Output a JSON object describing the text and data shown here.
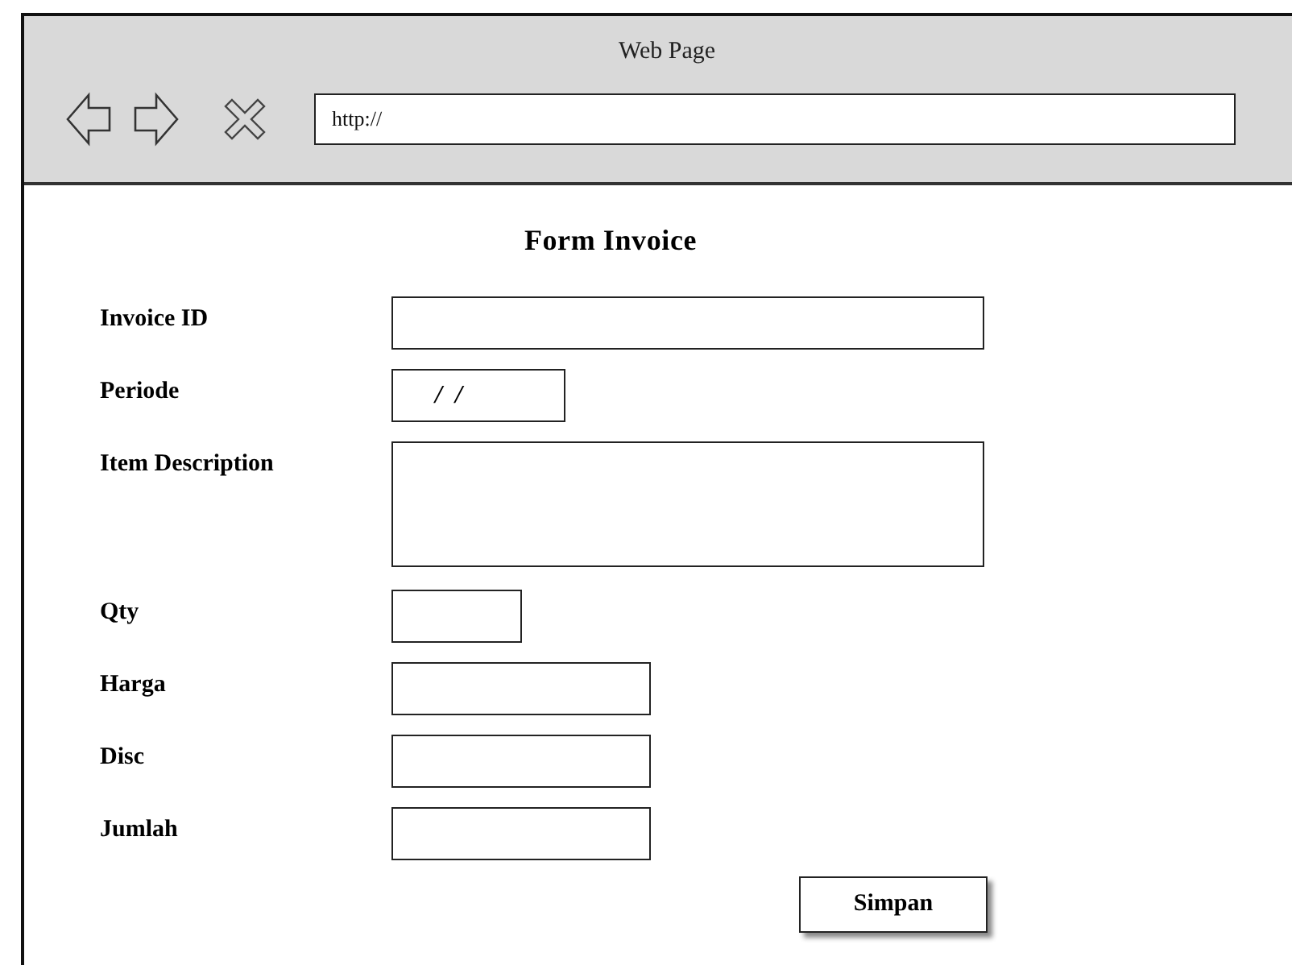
{
  "window": {
    "title": "Web Page"
  },
  "address_bar": {
    "value": "http://"
  },
  "form": {
    "title": "Form Invoice",
    "fields": [
      {
        "label": "Invoice ID",
        "kind": "wide"
      },
      {
        "label": "Periode",
        "kind": "date",
        "value": "/  /"
      },
      {
        "label": "Item Description",
        "kind": "textarea"
      },
      {
        "label": "Qty",
        "kind": "tiny"
      },
      {
        "label": "Harga",
        "kind": "medium"
      },
      {
        "label": "Disc",
        "kind": "medium"
      },
      {
        "label": "Jumlah",
        "kind": "medium"
      }
    ],
    "submit": "Simpan"
  }
}
